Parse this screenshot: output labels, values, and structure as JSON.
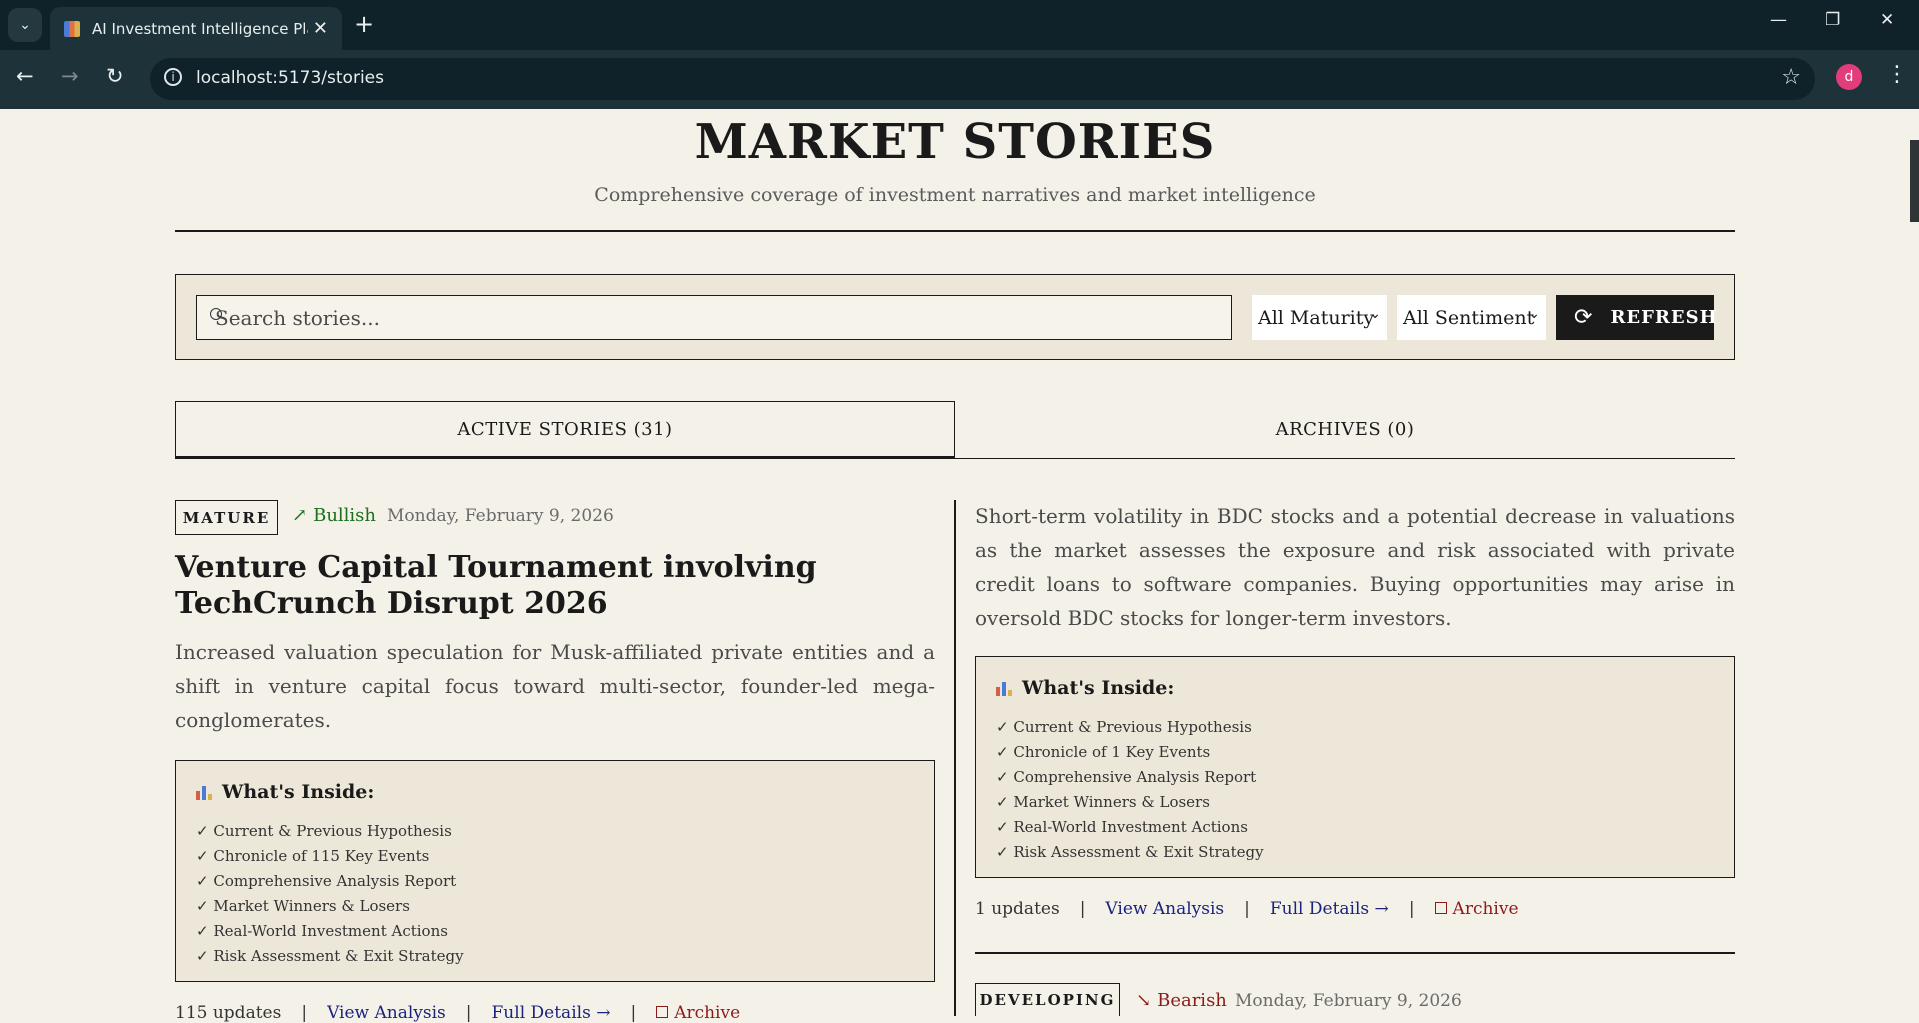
{
  "browser": {
    "tab_title": "AI Investment Intelligence Platform",
    "url": "localhost:5173/stories",
    "profile_initial": "d"
  },
  "page": {
    "title": "MARKET STORIES",
    "subtitle": "Comprehensive coverage of investment narratives and market intelligence"
  },
  "filters": {
    "search_placeholder": "Search stories...",
    "maturity": "All Maturity",
    "sentiment": "All Sentiment",
    "refresh_label": "REFRESH"
  },
  "tabs": {
    "active": "ACTIVE STORIES (31)",
    "archives": "ARCHIVES (0)"
  },
  "stories": [
    {
      "maturity": "MATURE",
      "sentiment": "Bullish",
      "sentiment_color": "#1b6e1b",
      "date": "Monday, February 9, 2026",
      "title": "Venture Capital Tournament involving TechCrunch Disrupt 2026",
      "summary": "Increased valuation speculation for Musk-affiliated private entities and a shift in venture capital focus toward multi-sector, founder-led mega-conglomerates.",
      "inside_title": "What's Inside:",
      "inside_items": [
        "✓ Current & Previous Hypothesis",
        "✓ Chronicle of 115 Key Events",
        "✓ Comprehensive Analysis Report",
        "✓ Market Winners & Losers",
        "✓ Real-World Investment Actions",
        "✓ Risk Assessment & Exit Strategy"
      ],
      "updates": "115 updates",
      "view_analysis": "View Analysis",
      "full_details": "Full Details →",
      "archive": "Archive"
    },
    {
      "summary": "Short-term volatility in BDC stocks and a potential decrease in valuations as the market assesses the exposure and risk associated with private credit loans to software companies. Buying opportunities may arise in oversold BDC stocks for longer-term investors.",
      "inside_title": "What's Inside:",
      "inside_items": [
        "✓ Current & Previous Hypothesis",
        "✓ Chronicle of 1 Key Events",
        "✓ Comprehensive Analysis Report",
        "✓ Market Winners & Losers",
        "✓ Real-World Investment Actions",
        "✓ Risk Assessment & Exit Strategy"
      ],
      "updates": "1 updates",
      "view_analysis": "View Analysis",
      "full_details": "Full Details →",
      "archive": "Archive"
    },
    {
      "maturity": "DEVELOPING",
      "sentiment": "Bearish",
      "sentiment_color": "#8b1a1a",
      "date": "Monday, February 9, 2026"
    }
  ],
  "icons": {
    "bullish": "trending-up-icon",
    "bearish": "trending-down-icon",
    "archive": "archive-icon",
    "refresh": "refresh-icon",
    "whats_inside": "bar-chart-icon"
  }
}
